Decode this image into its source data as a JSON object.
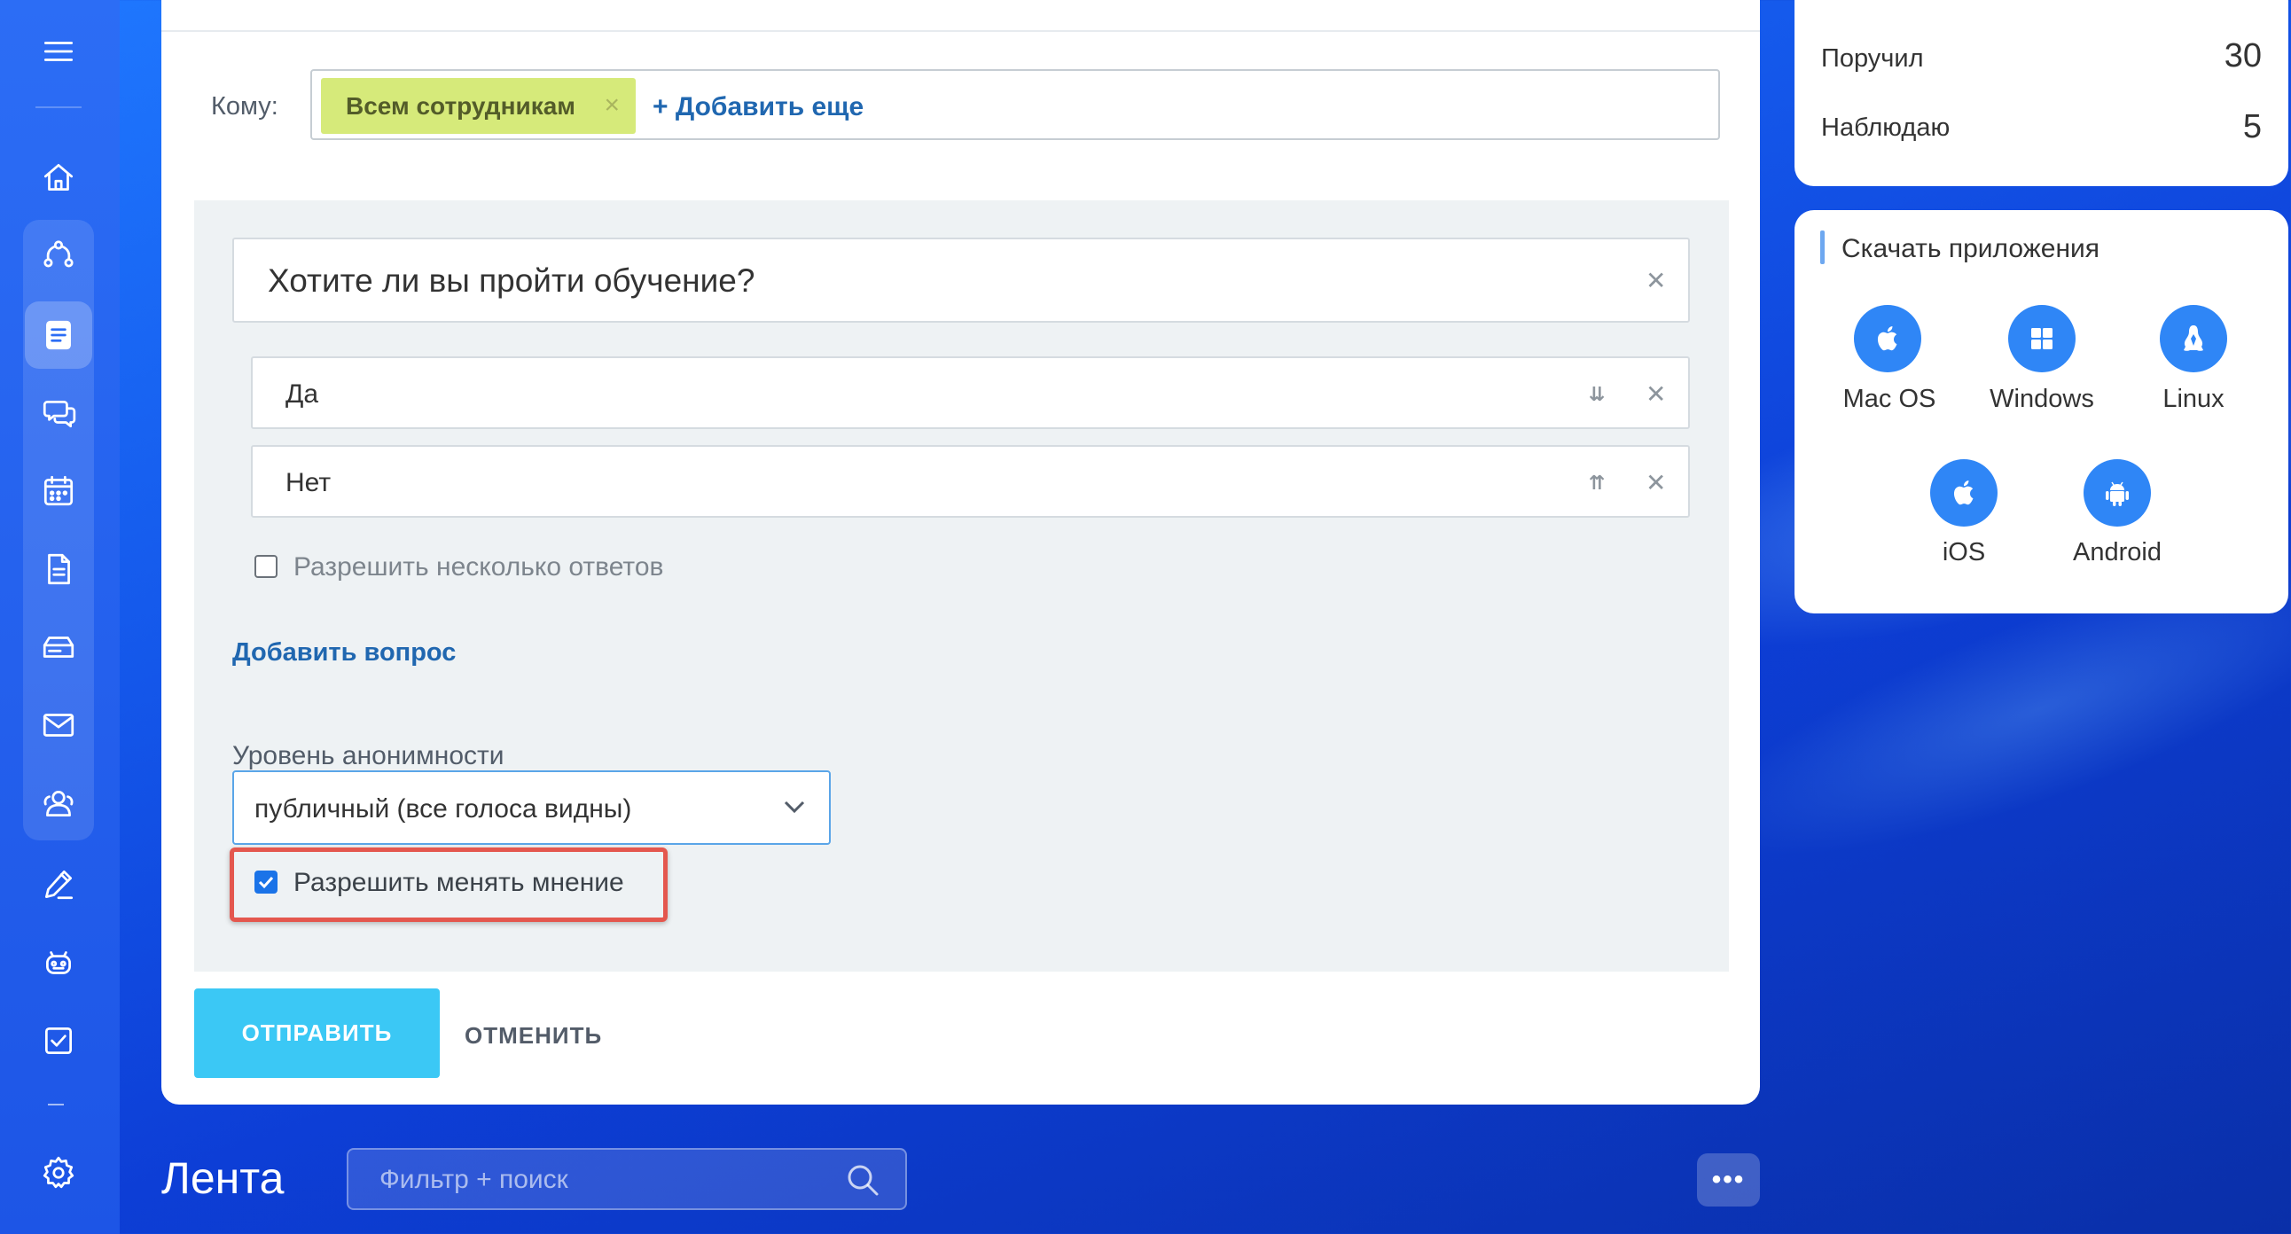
{
  "recipients": {
    "label": "Кому:",
    "chip": "Всем сотрудникам",
    "add_more": "+ Добавить еще"
  },
  "poll": {
    "question": "Хотите ли вы пройти обучение?",
    "answers": [
      "Да",
      "Нет"
    ],
    "multiple_answers_label": "Разрешить несколько ответов",
    "multiple_answers_checked": false,
    "add_question": "Добавить вопрос",
    "anonymity_label": "Уровень анонимности",
    "anonymity_value": "публичный (все голоса видны)",
    "change_vote_label": "Разрешить менять мнение",
    "change_vote_checked": true
  },
  "actions": {
    "send": "ОТПРАВИТЬ",
    "cancel": "ОТМЕНИТЬ"
  },
  "stats": {
    "assigned_label": "Поручил",
    "assigned_value": "30",
    "watching_label": "Наблюдаю",
    "watching_value": "5"
  },
  "apps": {
    "title": "Скачать приложения",
    "items": [
      {
        "label": "Mac OS",
        "icon": "apple-icon"
      },
      {
        "label": "Windows",
        "icon": "windows-icon"
      },
      {
        "label": "Linux",
        "icon": "linux-icon"
      },
      {
        "label": "iOS",
        "icon": "apple-icon"
      },
      {
        "label": "Android",
        "icon": "android-icon"
      }
    ]
  },
  "feed": {
    "title": "Лента",
    "search_placeholder": "Фильтр + поиск",
    "more": "•••"
  },
  "sidebar": {
    "icons": [
      "menu-icon",
      "home-icon",
      "flow-icon",
      "feed-icon",
      "chat-icon",
      "calendar-icon",
      "document-icon",
      "storage-icon",
      "mail-icon",
      "contacts-icon",
      "sign-icon",
      "robot-icon",
      "tasks-icon",
      "settings-icon"
    ]
  },
  "colors": {
    "accent": "#3bc8f5",
    "link": "#2067b0",
    "chip": "#d6ea7a",
    "highlight": "#e4574e"
  }
}
